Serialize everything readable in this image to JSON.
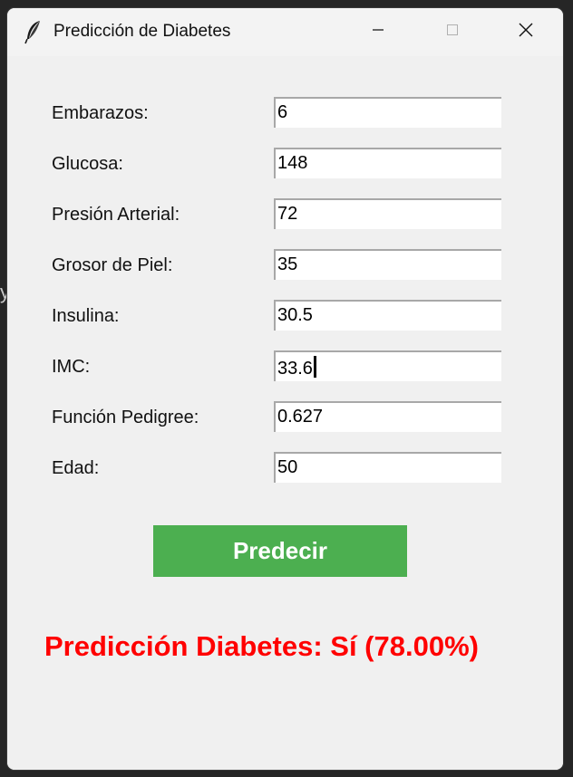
{
  "window": {
    "title": "Predicción de Diabetes"
  },
  "backdrop": {
    "side_glyph": "y"
  },
  "form": {
    "fields": [
      {
        "label": "Embarazos:",
        "value": "6"
      },
      {
        "label": "Glucosa:",
        "value": "148"
      },
      {
        "label": "Presión Arterial:",
        "value": "72"
      },
      {
        "label": "Grosor de Piel:",
        "value": "35"
      },
      {
        "label": "Insulina:",
        "value": "30.5"
      },
      {
        "label": "IMC:",
        "value": "33.6"
      },
      {
        "label": "Función Pedigree:",
        "value": "0.627"
      },
      {
        "label": "Edad:",
        "value": "50"
      }
    ],
    "focused_field": "IMC:"
  },
  "actions": {
    "predict_label": "Predecir"
  },
  "result": {
    "text": "Predicción Diabetes: Sí (78.00%)"
  },
  "icons": {
    "app": "feather-icon",
    "minimize": "minimize-icon",
    "maximize": "maximize-icon",
    "close": "close-icon"
  },
  "colors": {
    "button_bg": "#4caf50",
    "button_text": "#ffffff",
    "result_text": "#ff0000",
    "window_bg": "#f0f0f0"
  }
}
